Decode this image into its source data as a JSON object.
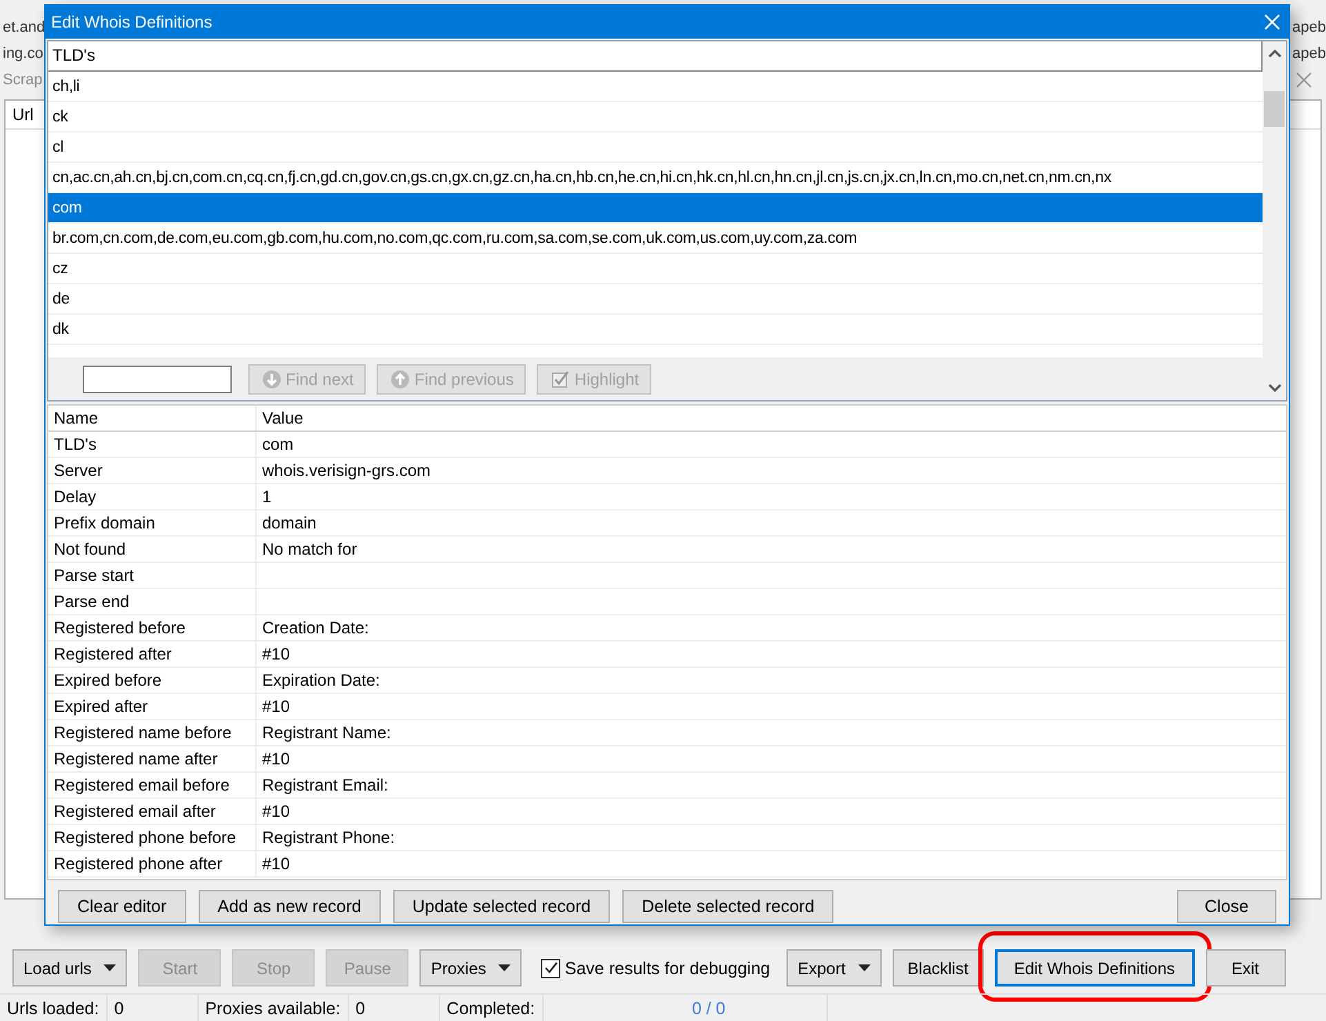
{
  "background_window": {
    "left_fragments": [
      "et.and",
      "ing.co",
      "Scrap"
    ],
    "right_fragments": [
      "apeb",
      "apeb"
    ],
    "table": {
      "columns": [
        "Url"
      ]
    }
  },
  "dialog": {
    "title": "Edit Whois Definitions",
    "tld_list": {
      "header": "TLD's",
      "items": [
        {
          "text": "ch,li",
          "selected": false
        },
        {
          "text": "ck",
          "selected": false
        },
        {
          "text": "cl",
          "selected": false
        },
        {
          "text": "cn,ac.cn,ah.cn,bj.cn,com.cn,cq.cn,fj.cn,gd.cn,gov.cn,gs.cn,gx.cn,gz.cn,ha.cn,hb.cn,he.cn,hi.cn,hk.cn,hl.cn,hn.cn,jl.cn,js.cn,jx.cn,ln.cn,mo.cn,net.cn,nm.cn,nx",
          "selected": false
        },
        {
          "text": "com",
          "selected": true
        },
        {
          "text": "br.com,cn.com,de.com,eu.com,gb.com,hu.com,no.com,qc.com,ru.com,sa.com,se.com,uk.com,us.com,uy.com,za.com",
          "selected": false
        },
        {
          "text": "cz",
          "selected": false
        },
        {
          "text": "de",
          "selected": false
        },
        {
          "text": "dk",
          "selected": false
        }
      ]
    },
    "find_bar": {
      "buttons": [
        {
          "label": "Find next",
          "kind": "down",
          "disabled": true
        },
        {
          "label": "Find previous",
          "kind": "up",
          "disabled": true
        },
        {
          "label": "Highlight",
          "kind": "check",
          "disabled": true
        }
      ]
    },
    "properties": {
      "columns": [
        "Name",
        "Value"
      ],
      "rows": [
        {
          "name": "TLD's",
          "value": "com"
        },
        {
          "name": "Server",
          "value": "whois.verisign-grs.com"
        },
        {
          "name": "Delay",
          "value": "1"
        },
        {
          "name": "Prefix domain",
          "value": " domain"
        },
        {
          "name": "Not found",
          "value": "No match for"
        },
        {
          "name": "Parse start"
        },
        {
          "name": "Parse end"
        },
        {
          "name": "Registered before",
          "value": "Creation Date:"
        },
        {
          "name": "Registered after",
          "value": "#10"
        },
        {
          "name": "Expired before",
          "value": "Expiration Date:"
        },
        {
          "name": "Expired after",
          "value": "#10"
        },
        {
          "name": "Registered name before",
          "value": "Registrant Name:"
        },
        {
          "name": "Registered name after",
          "value": "#10"
        },
        {
          "name": "Registered email before",
          "value": "Registrant Email:"
        },
        {
          "name": "Registered email after",
          "value": "#10"
        },
        {
          "name": "Registered phone before",
          "value": "Registrant Phone:"
        },
        {
          "name": "Registered phone after",
          "value": "#10"
        }
      ]
    },
    "buttons": [
      "Clear editor",
      "Add as new record",
      "Update selected record",
      "Delete selected record"
    ],
    "close_button": "Close"
  },
  "toolbar": [
    {
      "kind": "dropdown",
      "label": "Load urls",
      "disabled": false,
      "focused": false,
      "circled": false
    },
    {
      "kind": "button",
      "label": "Start",
      "disabled": true,
      "focused": false,
      "circled": false
    },
    {
      "kind": "button",
      "label": "Stop",
      "disabled": true,
      "focused": false,
      "circled": false
    },
    {
      "kind": "button",
      "label": "Pause",
      "disabled": true,
      "focused": false,
      "circled": false
    },
    {
      "kind": "dropdown",
      "label": "Proxies",
      "disabled": false,
      "focused": false,
      "circled": false
    },
    {
      "kind": "checkbox",
      "label": "Save results for debugging",
      "checked": true
    },
    {
      "kind": "dropdown",
      "label": "Export",
      "disabled": false,
      "focused": false,
      "circled": false
    },
    {
      "kind": "button",
      "label": "Blacklist",
      "disabled": false,
      "focused": false,
      "circled": false
    },
    {
      "kind": "button",
      "label": "Edit Whois Definitions",
      "disabled": false,
      "focused": true,
      "circled": true
    },
    {
      "kind": "button",
      "label": "Exit",
      "disabled": false,
      "focused": false,
      "circled": false
    }
  ],
  "status_bar": [
    {
      "label": "Urls loaded:",
      "value": "0"
    },
    {
      "label": "Proxies available:",
      "value": "0"
    },
    {
      "label": "Completed:",
      "value": "0 / 0"
    }
  ]
}
